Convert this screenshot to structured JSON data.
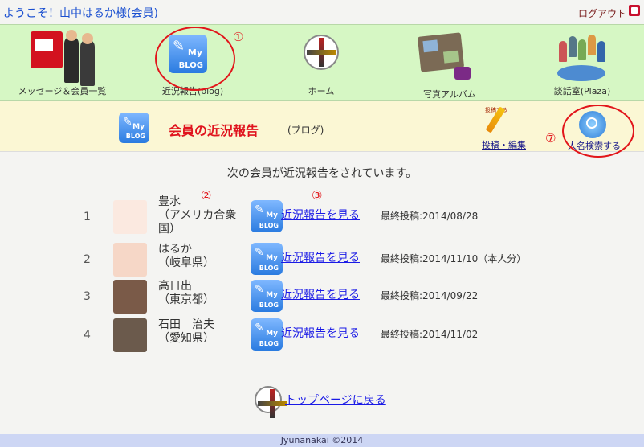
{
  "top": {
    "welcome": "ようこそ！山中はるか様(会員)",
    "logout": "ログアウト"
  },
  "nav": [
    {
      "label": "メッセージ＆会員一覧",
      "icon": "mail-members-icon"
    },
    {
      "label": "近況報告(blog)",
      "icon": "myblog-icon"
    },
    {
      "label": "ホーム",
      "icon": "compass-icon"
    },
    {
      "label": "写真アルバム",
      "icon": "photo-album-icon"
    },
    {
      "label": "談話室(Plaza)",
      "icon": "plaza-icon"
    }
  ],
  "markers": {
    "m1": "①",
    "m2": "②",
    "m3": "③",
    "m7": "⑦"
  },
  "blog_icon_text": {
    "my": "My",
    "blog": "BLOG"
  },
  "header": {
    "title": "会員の近況報告",
    "subtitle": "(ブログ)",
    "post_label": "投稿・編集",
    "pencil_text": "投稿する",
    "search_label": "人名検索する"
  },
  "main": {
    "intro": "次の会員が近況報告をされています。",
    "rows": [
      {
        "num": "1",
        "name": "豊水\n（アメリカ合衆\n国）",
        "link": "近況報告を見る",
        "date": "最終投稿:2014/08/28",
        "avatar_color": "#fbe9e0"
      },
      {
        "num": "2",
        "name": "はるか\n（岐阜県）",
        "link": "近況報告を見る",
        "date": "最終投稿:2014/11/10（本人分）",
        "avatar_color": "#f6d7c7"
      },
      {
        "num": "3",
        "name": "高日出\n（東京都）",
        "link": "近況報告を見る",
        "date": "最終投稿:2014/09/22",
        "avatar_color": "#7a5a48"
      },
      {
        "num": "4",
        "name": "石田　治夫\n（愛知県）",
        "link": "近況報告を見る",
        "date": "最終投稿:2014/11/02",
        "avatar_color": "#6b5a4c"
      }
    ],
    "top_link": "トップページに戻る"
  },
  "footer": "Jyunanakai ©2014",
  "colors": {
    "accent_red": "#e2161b",
    "nav_bg": "#d6f7c4",
    "header_bg": "#fbf7d4",
    "link": "#1a1ae6"
  }
}
